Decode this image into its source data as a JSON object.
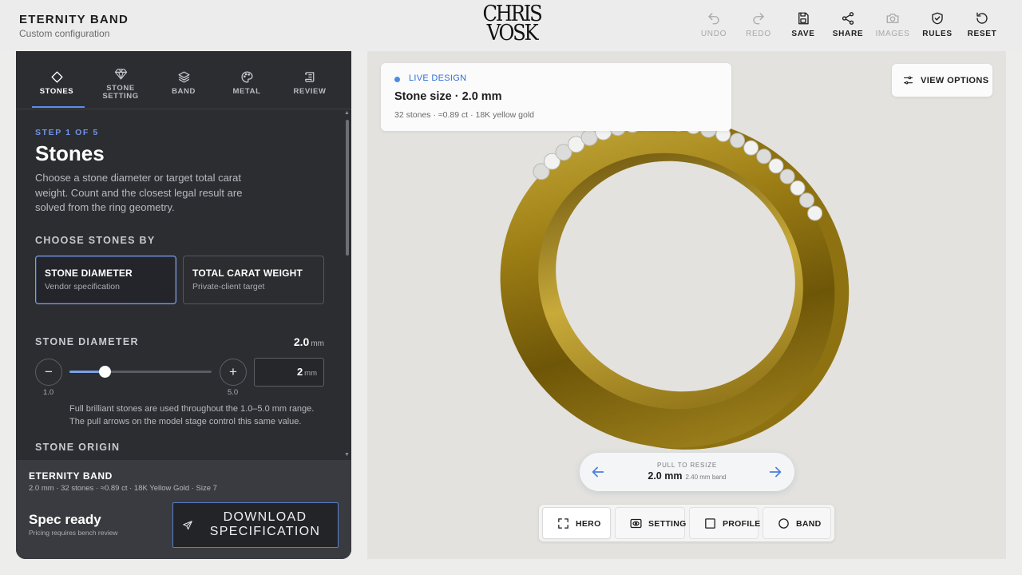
{
  "header": {
    "title": "ETERNITY BAND",
    "subtitle": "Custom configuration",
    "logo_line1": "CHRIS",
    "logo_line2": "VOSK",
    "toolbar": [
      {
        "label": "UNDO",
        "icon": "undo-icon",
        "enabled": false
      },
      {
        "label": "REDO",
        "icon": "redo-icon",
        "enabled": false
      },
      {
        "label": "SAVE",
        "icon": "save-icon",
        "enabled": true
      },
      {
        "label": "SHARE",
        "icon": "share-icon",
        "enabled": true
      },
      {
        "label": "IMAGES",
        "icon": "camera-icon",
        "enabled": false
      },
      {
        "label": "RULES",
        "icon": "shield-check-icon",
        "enabled": true
      },
      {
        "label": "RESET",
        "icon": "reset-icon",
        "enabled": true
      }
    ]
  },
  "tabs": [
    {
      "label": "STONES",
      "icon": "diamond-icon",
      "active": true
    },
    {
      "label": "STONE\nSETTING",
      "icon": "gem-icon",
      "active": false
    },
    {
      "label": "BAND",
      "icon": "layers-icon",
      "active": false
    },
    {
      "label": "METAL",
      "icon": "palette-icon",
      "active": false
    },
    {
      "label": "REVIEW",
      "icon": "scroll-icon",
      "active": false
    }
  ],
  "step": {
    "label": "STEP 1 OF 5",
    "title": "Stones",
    "description": "Choose a stone diameter or target total carat weight. Count and the closest legal result are solved from the ring geometry."
  },
  "choose_by": {
    "heading": "CHOOSE STONES BY",
    "options": [
      {
        "title": "STONE DIAMETER",
        "subtitle": "Vendor specification",
        "selected": true
      },
      {
        "title": "TOTAL CARAT WEIGHT",
        "subtitle": "Private-client target",
        "selected": false
      }
    ]
  },
  "diameter": {
    "heading": "STONE DIAMETER",
    "value": "2.0",
    "unit": "mm",
    "min_label": "1.0",
    "max_label": "5.0",
    "min": 1.0,
    "max": 5.0,
    "current": 2.0,
    "input_value": "2",
    "input_unit": "mm",
    "decrement": "−",
    "increment": "+",
    "note": "Full brilliant stones are used throughout the 1.0–5.0 mm range. The pull arrows on the model stage control this same value."
  },
  "origin": {
    "heading": "STONE ORIGIN"
  },
  "footer": {
    "title": "ETERNITY BAND",
    "meta": "2.0 mm · 32 stones · ≈0.89 ct · 18K Yellow Gold · Size 7",
    "status": "Spec ready",
    "status_sub": "Pricing requires bench review",
    "download_label": "DOWNLOAD SPECIFICATION"
  },
  "live_card": {
    "label": "LIVE DESIGN",
    "title": "Stone size · 2.0 mm",
    "meta": "32 stones  ·  ≈0.89 ct  ·  18K yellow gold"
  },
  "view_options": {
    "label": "VIEW OPTIONS"
  },
  "resize": {
    "label": "PULL TO RESIZE",
    "value": "2.0 mm",
    "sub": "2.40 mm band"
  },
  "views": [
    {
      "label": "HERO",
      "icon": "expand-icon",
      "active": true
    },
    {
      "label": "SETTING",
      "icon": "eye-icon",
      "active": false
    },
    {
      "label": "PROFILE",
      "icon": "square-icon",
      "active": false
    },
    {
      "label": "BAND",
      "icon": "circle-icon",
      "active": false
    }
  ],
  "colors": {
    "accent": "#5b8def",
    "panel_bg": "#2c2d31",
    "gold": "#a98a1e"
  }
}
